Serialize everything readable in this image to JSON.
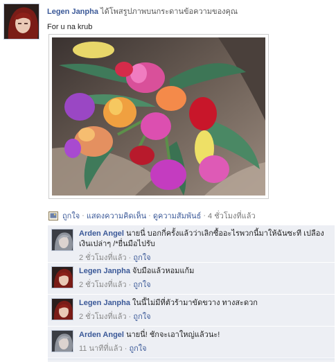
{
  "post": {
    "author": "Legen Janpha",
    "action": "ได้โพสรูปภาพบนกระดานข้อความของคุณ",
    "message": "For u na krub",
    "actions": {
      "like": "ถูกใจ",
      "comment": "แสดงความคิดเห็น",
      "relationship": "ดูความสัมพันธ์",
      "time": "4 ชั่วโมงที่แล้ว",
      "separator": "·"
    }
  },
  "comments": [
    {
      "author": "Arden Angel",
      "text": "นายนี่ บอกกี่ครั้งแล้วว่าเลิกซื้ออะไรพวกนี้มาให้ฉันซะที เปลืองเงินเปล่าๆ /*ยื่นมือไปรับ",
      "time": "2 ชั่วโมงที่แล้ว",
      "like": "ถูกใจ",
      "avatar": "grey-hair-avatar"
    },
    {
      "author": "Legen Janpha",
      "text": "จับมือแล้วหอมแก้ม",
      "time": "2 ชั่วโมงที่แล้ว",
      "like": "ถูกใจ",
      "avatar": "red-hair-avatar"
    },
    {
      "author": "Legen Janpha",
      "text": "ในนี้ไม่มีที่ตัวร้ามาขัดขวาง ทางสะดวก",
      "time": "2 ชั่วโมงที่แล้ว",
      "like": "ถูกใจ",
      "avatar": "red-hair-avatar"
    },
    {
      "author": "Arden Angel",
      "text": "นายนี่! ชักจะเอาใหญ่แล้วนะ!",
      "time": "11 นาทีที่แล้ว",
      "like": "ถูกใจ",
      "avatar": "grey-hair-avatar"
    }
  ],
  "colors": {
    "link": "#3b5998",
    "comment_bg": "#edeff4"
  }
}
